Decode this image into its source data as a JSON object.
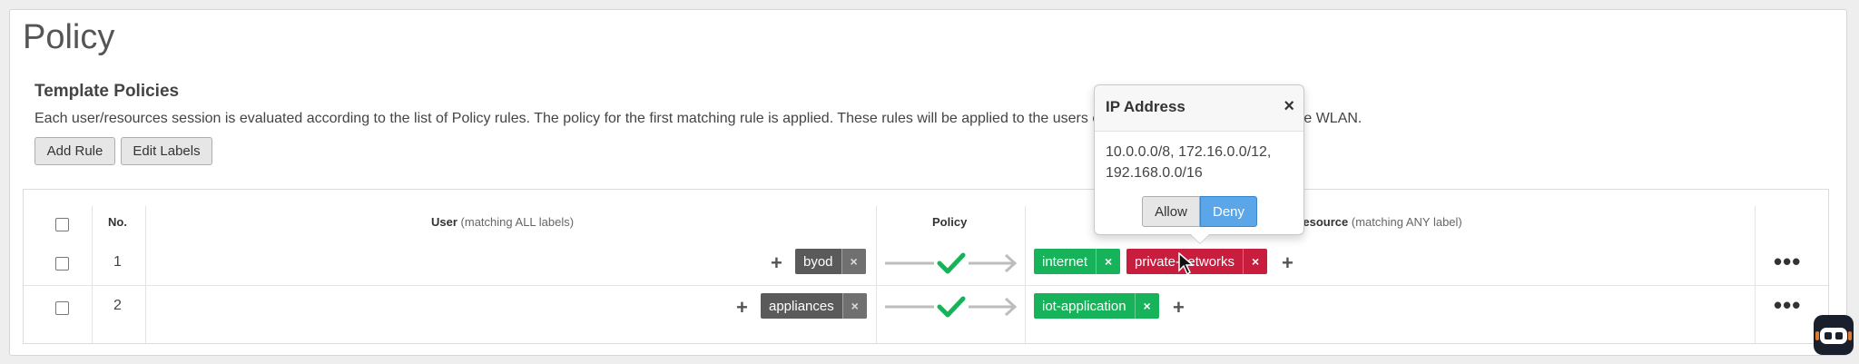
{
  "page": {
    "title": "Policy",
    "section_title": "Template Policies",
    "description": "Each user/resources session is evaluated according to the list of Policy rules. The policy for the first matching rule is applied. These rules will be applied to the users connecting to the current template WLAN.",
    "add_rule_label": "Add Rule",
    "edit_labels_label": "Edit Labels"
  },
  "table": {
    "headers": {
      "no": "No.",
      "user": "User",
      "user_sub": "(matching ALL labels)",
      "policy": "Policy",
      "resource": "Resource",
      "resource_sub": "(matching ANY label)"
    },
    "rows": [
      {
        "number": "1",
        "user_tags": [
          "byod"
        ],
        "resource_tags": [
          {
            "label": "internet",
            "color": "#16b35a"
          },
          {
            "label": "private-networks",
            "color": "#c81d3c"
          }
        ]
      },
      {
        "number": "2",
        "user_tags": [
          "appliances"
        ],
        "resource_tags": [
          {
            "label": "iot-application",
            "color": "#16b35a"
          }
        ]
      }
    ]
  },
  "popover": {
    "title": "IP Address",
    "close": "×",
    "body_line1": "10.0.0.0/8, 172.16.0.0/12,",
    "body_line2": "192.168.0.0/16",
    "allow_label": "Allow",
    "deny_label": "Deny",
    "selected": "Deny"
  },
  "icons": {
    "remove": "×",
    "add": "+",
    "more": "•••"
  },
  "colors": {
    "allow_check": "#16b35a",
    "deny_active": "#5aa6e8"
  }
}
